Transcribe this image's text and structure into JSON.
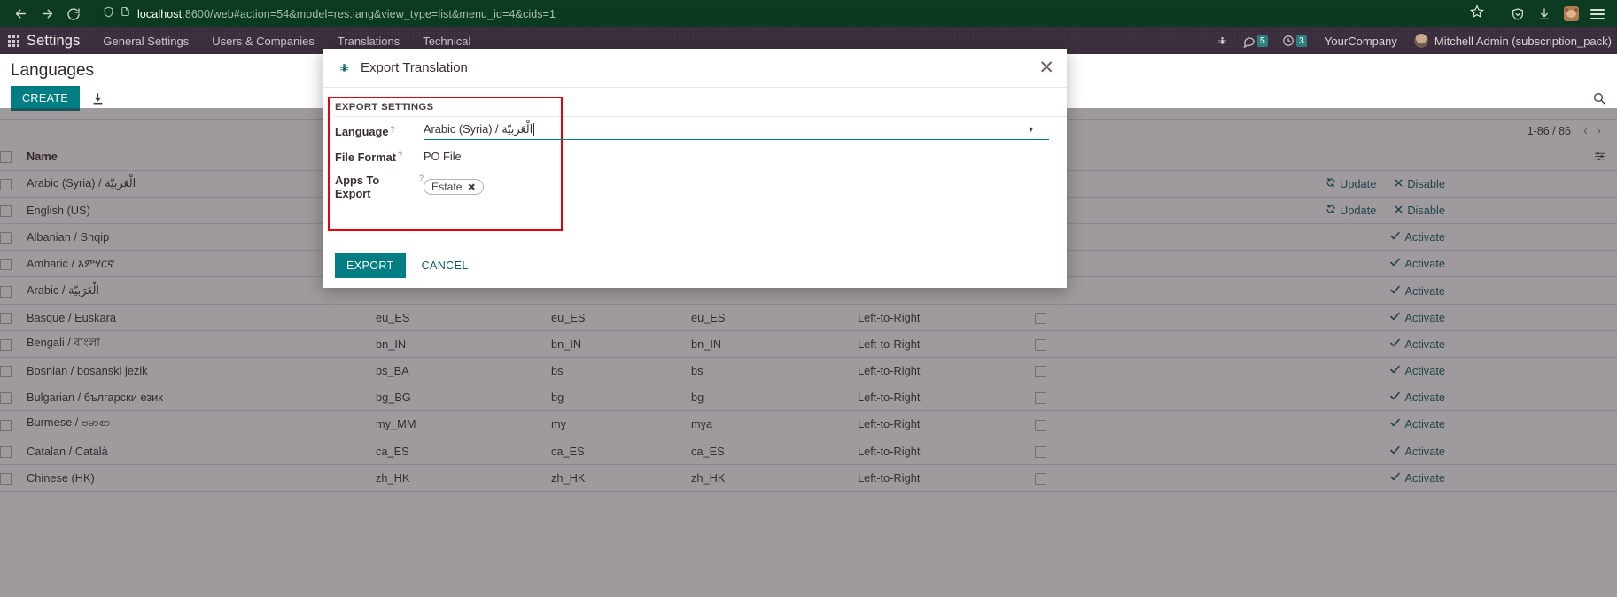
{
  "browser": {
    "back_icon": "arrow-left-icon",
    "forward_icon": "arrow-right-icon",
    "reload_icon": "reload-icon",
    "url_host": "localhost",
    "url_rest": ":8600/web#action=54&model=res.lang&view_type=list&menu_id=4&cids=1",
    "url_full": "localhost:8600/web#action=54&model=res.lang&view_type=list&menu_id=4&cids=1",
    "shield_icon": "shield-icon",
    "page_icon": "page-icon",
    "bookmark_icon": "star-icon",
    "pocket_icon": "shield-check-icon",
    "download_icon": "download-icon",
    "profile_icon": "monkey-avatar-icon",
    "menu_icon": "hamburger-menu-icon",
    "chrome_bg": "#0c3b22"
  },
  "topbar": {
    "apps_icon": "apps-grid-icon",
    "brand": "Settings",
    "menu": [
      {
        "label": "General Settings"
      },
      {
        "label": "Users & Companies"
      },
      {
        "label": "Translations"
      },
      {
        "label": "Technical"
      }
    ],
    "debug_icon": "bug-icon",
    "messages_icon": "chat-bubble-icon",
    "messages_count": "5",
    "activities_icon": "clock-icon",
    "activities_count": "3",
    "company": "YourCompany",
    "user_avatar_icon": "user-avatar",
    "user": "Mitchell Admin (subscription_pack)",
    "bar_bg": "#3b2e3c",
    "badge_color": "#2b7f7e"
  },
  "controlpanel": {
    "title": "Languages",
    "create_label": "CREATE",
    "import_icon": "import-icon",
    "search_icon": "search-icon",
    "pager": "1-86 / 86",
    "prev_icon": "chevron-left-icon",
    "next_icon": "chevron-right-icon",
    "options_icon": "column-options-icon",
    "accent": "#017e84"
  },
  "list": {
    "columns": [
      "Name",
      "",
      "",
      "",
      "",
      ""
    ],
    "header_name": "Name",
    "select_all_icon": "checkbox",
    "rows": [
      {
        "name": "Arabic (Syria) / الْعَرَبيّة",
        "code": "",
        "iso": "",
        "url": "",
        "direction": "",
        "legacy": false,
        "actions": [
          {
            "icon": "refresh-icon",
            "label": "Update"
          },
          {
            "icon": "x-icon",
            "label": "Disable"
          }
        ]
      },
      {
        "name": "English (US)",
        "code": "",
        "iso": "",
        "url": "",
        "direction": "",
        "legacy": false,
        "actions": [
          {
            "icon": "refresh-icon",
            "label": "Update"
          },
          {
            "icon": "x-icon",
            "label": "Disable"
          }
        ]
      },
      {
        "name": "Albanian / Shqip",
        "code": "",
        "iso": "",
        "url": "",
        "direction": "",
        "legacy": false,
        "actions": [
          {
            "icon": "check-icon",
            "label": "Activate"
          }
        ]
      },
      {
        "name": "Amharic / አምሃርኛ",
        "code": "",
        "iso": "",
        "url": "",
        "direction": "",
        "legacy": false,
        "actions": [
          {
            "icon": "check-icon",
            "label": "Activate"
          }
        ]
      },
      {
        "name": "Arabic / الْعَرَبيّة",
        "code": "",
        "iso": "",
        "url": "",
        "direction": "",
        "legacy": false,
        "actions": [
          {
            "icon": "check-icon",
            "label": "Activate"
          }
        ]
      },
      {
        "name": "Basque / Euskara",
        "code": "eu_ES",
        "iso": "eu_ES",
        "url": "eu_ES",
        "direction": "Left-to-Right",
        "legacy": false,
        "actions": [
          {
            "icon": "check-icon",
            "label": "Activate"
          }
        ]
      },
      {
        "name": "Bengali / বাংলা",
        "code": "bn_IN",
        "iso": "bn_IN",
        "url": "bn_IN",
        "direction": "Left-to-Right",
        "legacy": false,
        "actions": [
          {
            "icon": "check-icon",
            "label": "Activate"
          }
        ]
      },
      {
        "name": "Bosnian / bosanski jezik",
        "code": "bs_BA",
        "iso": "bs",
        "url": "bs",
        "direction": "Left-to-Right",
        "legacy": false,
        "actions": [
          {
            "icon": "check-icon",
            "label": "Activate"
          }
        ]
      },
      {
        "name": "Bulgarian / български език",
        "code": "bg_BG",
        "iso": "bg",
        "url": "bg",
        "direction": "Left-to-Right",
        "legacy": false,
        "actions": [
          {
            "icon": "check-icon",
            "label": "Activate"
          }
        ]
      },
      {
        "name": "Burmese / ဗမာစာ",
        "code": "my_MM",
        "iso": "my",
        "url": "mya",
        "direction": "Left-to-Right",
        "legacy": false,
        "actions": [
          {
            "icon": "check-icon",
            "label": "Activate"
          }
        ]
      },
      {
        "name": "Catalan / Català",
        "code": "ca_ES",
        "iso": "ca_ES",
        "url": "ca_ES",
        "direction": "Left-to-Right",
        "legacy": false,
        "actions": [
          {
            "icon": "check-icon",
            "label": "Activate"
          }
        ]
      },
      {
        "name": "Chinese (HK)",
        "code": "zh_HK",
        "iso": "zh_HK",
        "url": "zh_HK",
        "direction": "Left-to-Right",
        "legacy": false,
        "actions": [
          {
            "icon": "check-icon",
            "label": "Activate"
          }
        ]
      }
    ]
  },
  "dialog": {
    "icon": "bug-icon",
    "title": "Export Translation",
    "close_icon": "close-icon",
    "section_title": "EXPORT SETTINGS",
    "fields": {
      "language_label": "Language",
      "language_value": "Arabic (Syria) / الْعَرَبيّة",
      "fileformat_label": "File Format",
      "fileformat_value": "PO File",
      "apps_label": "Apps To Export",
      "apps_tag": "Estate",
      "apps_tag_remove_icon": "remove-tag-icon",
      "help_marker": "?",
      "dropdown_icon": "caret-down-icon"
    },
    "export_label": "EXPORT",
    "cancel_label": "CANCEL",
    "highlight_color": "#e8000d",
    "accent": "#017e84"
  }
}
